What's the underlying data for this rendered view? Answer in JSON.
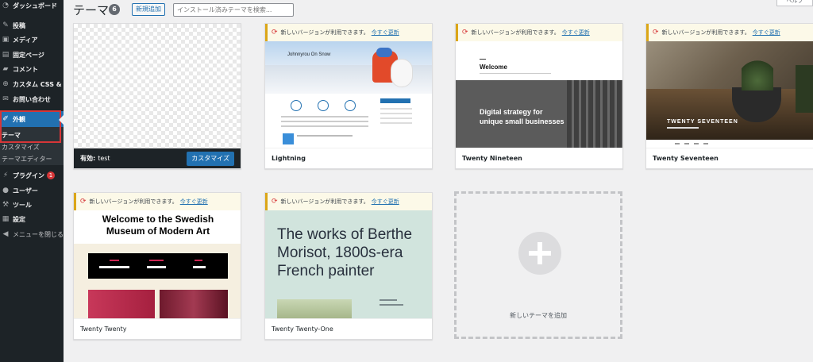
{
  "sidebar": {
    "items": [
      {
        "label": "ダッシュボード",
        "icon": "dashboard-icon"
      },
      {
        "label": "投稿",
        "icon": "pin-icon"
      },
      {
        "label": "メディア",
        "icon": "media-icon"
      },
      {
        "label": "固定ページ",
        "icon": "page-icon"
      },
      {
        "label": "コメント",
        "icon": "comment-icon"
      },
      {
        "label": "カスタム CSS & JS",
        "icon": "plus-circle-icon"
      },
      {
        "label": "お問い合わせ",
        "icon": "mail-icon"
      },
      {
        "label": "外観",
        "icon": "brush-icon"
      },
      {
        "label": "プラグイン",
        "icon": "plugin-icon"
      },
      {
        "label": "ユーザー",
        "icon": "user-icon"
      },
      {
        "label": "ツール",
        "icon": "wrench-icon"
      },
      {
        "label": "設定",
        "icon": "settings-icon"
      },
      {
        "label": "メニューを閉じる",
        "icon": "collapse-icon"
      }
    ],
    "submenu": [
      "テーマ",
      "カスタマイズ",
      "テーマエディター"
    ],
    "plugin_badge": "1",
    "accent_color": "#2271b1",
    "highlight_color": "#d63638"
  },
  "header": {
    "title": "テーマ",
    "count": "6",
    "add_new": "新規追加",
    "search_placeholder": "インストール済みテーマを検索...",
    "help": "ヘルプ"
  },
  "notice": {
    "text": "新しいバージョンが利用できます。",
    "link": "今すぐ更新"
  },
  "themes": [
    {
      "name": "test",
      "active_label": "有効:",
      "customize": "カスタマイズ"
    },
    {
      "name": "Lightning",
      "hero_text": "Johnnyrou On Snow"
    },
    {
      "name": "Twenty Nineteen",
      "welcome": "Welcome",
      "headline_1": "Digital strategy for",
      "headline_2": "unique small businesses"
    },
    {
      "name": "Twenty Seventeen",
      "brand": "TWENTY SEVENTEEN"
    },
    {
      "name": "Twenty Twenty",
      "heading_1": "Welcome to the Swedish",
      "heading_2": "Museum of Modern Art"
    },
    {
      "name": "Twenty Twenty-One",
      "heading_1": "The works of Berthe",
      "heading_2": "Morisot, 1800s-era",
      "heading_3": "French painter"
    }
  ],
  "add_theme_label": "新しいテーマを追加"
}
